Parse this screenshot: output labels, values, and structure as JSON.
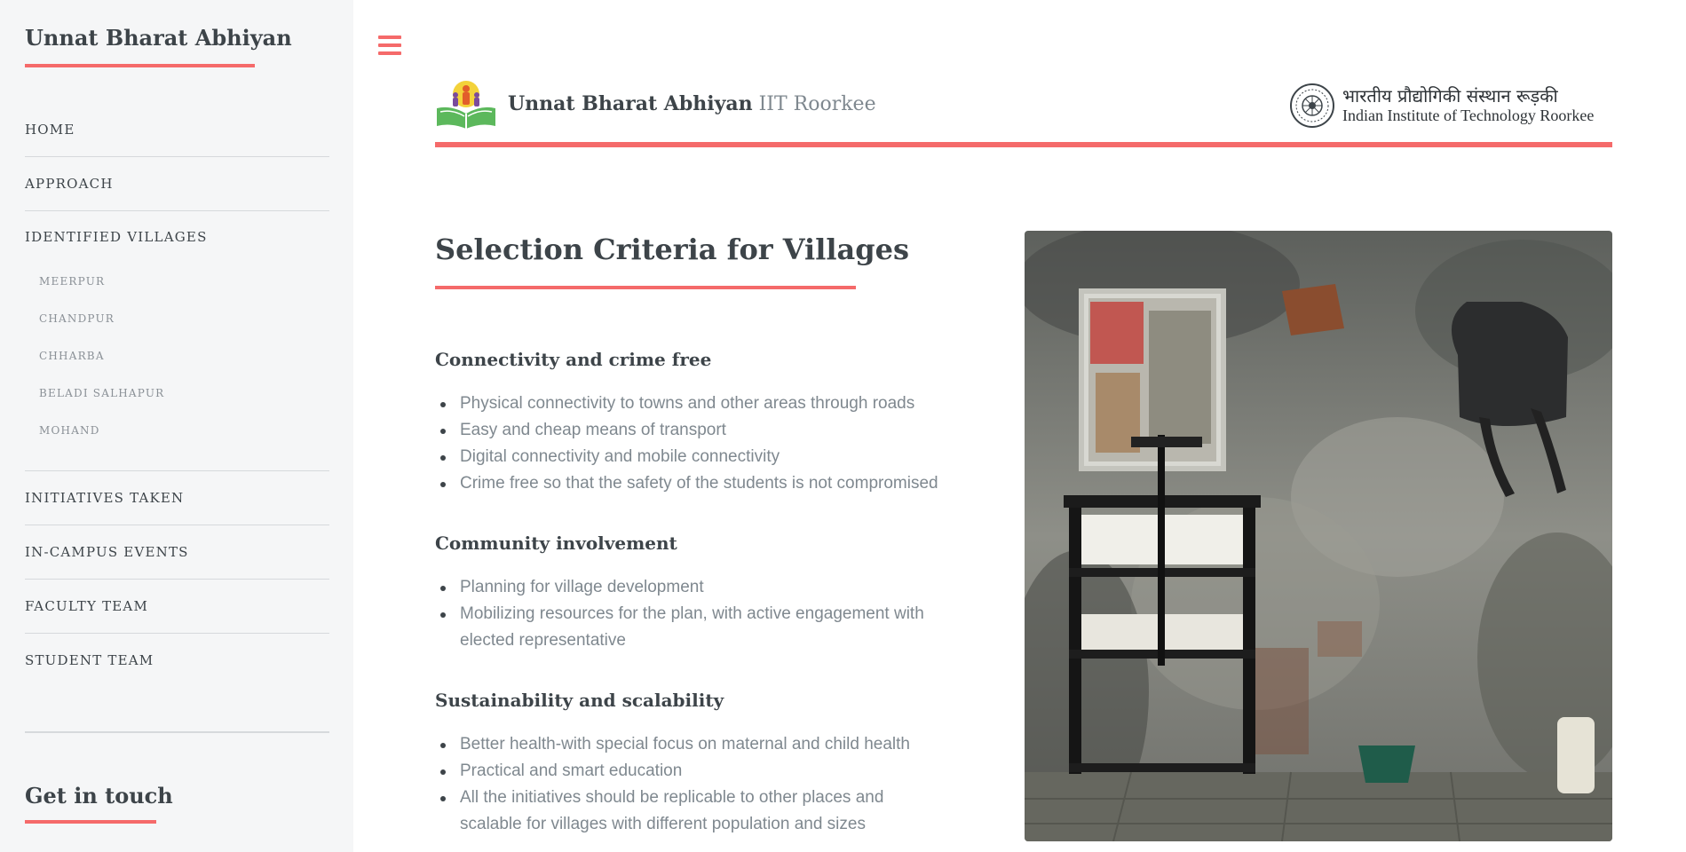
{
  "sidebar": {
    "title": "Unnat Bharat Abhiyan",
    "nav": {
      "home": "HOME",
      "approach": "APPROACH",
      "identified_villages": "IDENTIFIED VILLAGES",
      "villages": [
        "MEERPUR",
        "CHANDPUR",
        "CHHARBA",
        "BELADI SALHAPUR",
        "MOHAND"
      ],
      "initiatives": "INITIATIVES TAKEN",
      "events": "IN-CAMPUS EVENTS",
      "faculty": "FACULTY TEAM",
      "students": "STUDENT TEAM"
    },
    "contact_heading": "Get in touch"
  },
  "header": {
    "brand_bold": "Unnat Bharat Abhiyan",
    "brand_light": "IIT Roorkee",
    "iit_hindi": "भारतीय प्रौद्योगिकी संस्थान रूड़की",
    "iit_english": "Indian Institute of Technology Roorkee",
    "menu_icon": "hamburger-menu-icon"
  },
  "main": {
    "title": "Selection Criteria for Villages",
    "sections": [
      {
        "heading": "Connectivity and crime free",
        "items": [
          "Physical connectivity to towns and other areas through roads",
          "Easy and cheap means of transport",
          "Digital connectivity and mobile connectivity",
          "Crime free so that the safety of the students is not compromised"
        ]
      },
      {
        "heading": "Community involvement",
        "items": [
          "Planning for village development",
          "Mobilizing resources for the plan, with active engagement with elected representative"
        ]
      },
      {
        "heading": "Sustainability and scalability",
        "items": [
          "Better health-with special focus on maternal and child health",
          "Practical and smart education",
          "All the initiatives should be replicable to other places and scalable for villages with different population and sizes"
        ]
      }
    ]
  },
  "colors": {
    "accent": "#f56a6a",
    "text_dark": "#3d4449",
    "text_muted": "#7f888f",
    "sidebar_bg": "#f5f6f7"
  }
}
